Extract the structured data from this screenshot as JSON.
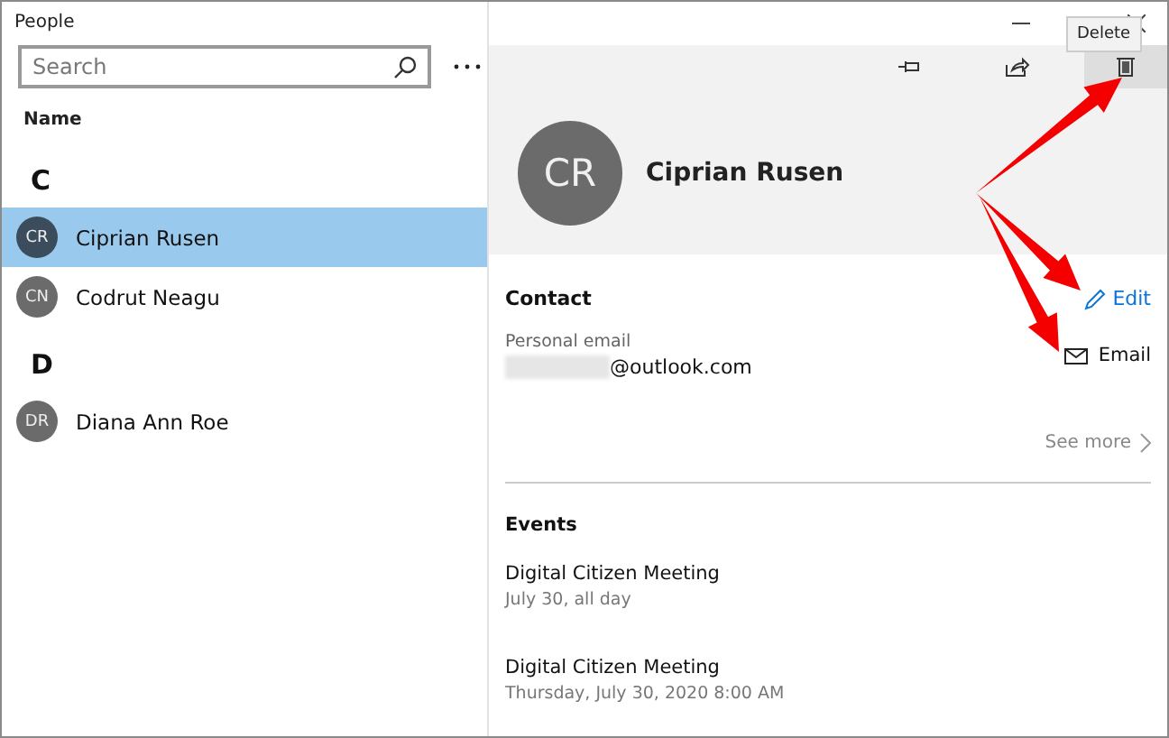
{
  "window": {
    "title": "People"
  },
  "search": {
    "placeholder": "Search"
  },
  "list_header": "Name",
  "groups": [
    {
      "letter": "C",
      "contacts": [
        {
          "initials": "CR",
          "name": "Ciprian Rusen",
          "selected": true
        },
        {
          "initials": "CN",
          "name": "Codrut Neagu",
          "selected": false
        }
      ]
    },
    {
      "letter": "D",
      "contacts": [
        {
          "initials": "DR",
          "name": "Diana Ann Roe",
          "selected": false
        }
      ]
    }
  ],
  "tooltip": "Delete",
  "contact": {
    "initials": "CR",
    "name": "Ciprian Rusen"
  },
  "contact_section": {
    "title": "Contact",
    "edit": "Edit",
    "field_label": "Personal email",
    "field_value": "@outlook.com",
    "action": "Email",
    "see_more": "See more"
  },
  "events": {
    "title": "Events",
    "items": [
      {
        "title": "Digital Citizen Meeting",
        "when": "July 30, all day"
      },
      {
        "title": "Digital Citizen Meeting",
        "when": "Thursday, July 30, 2020 8:00 AM"
      }
    ]
  }
}
